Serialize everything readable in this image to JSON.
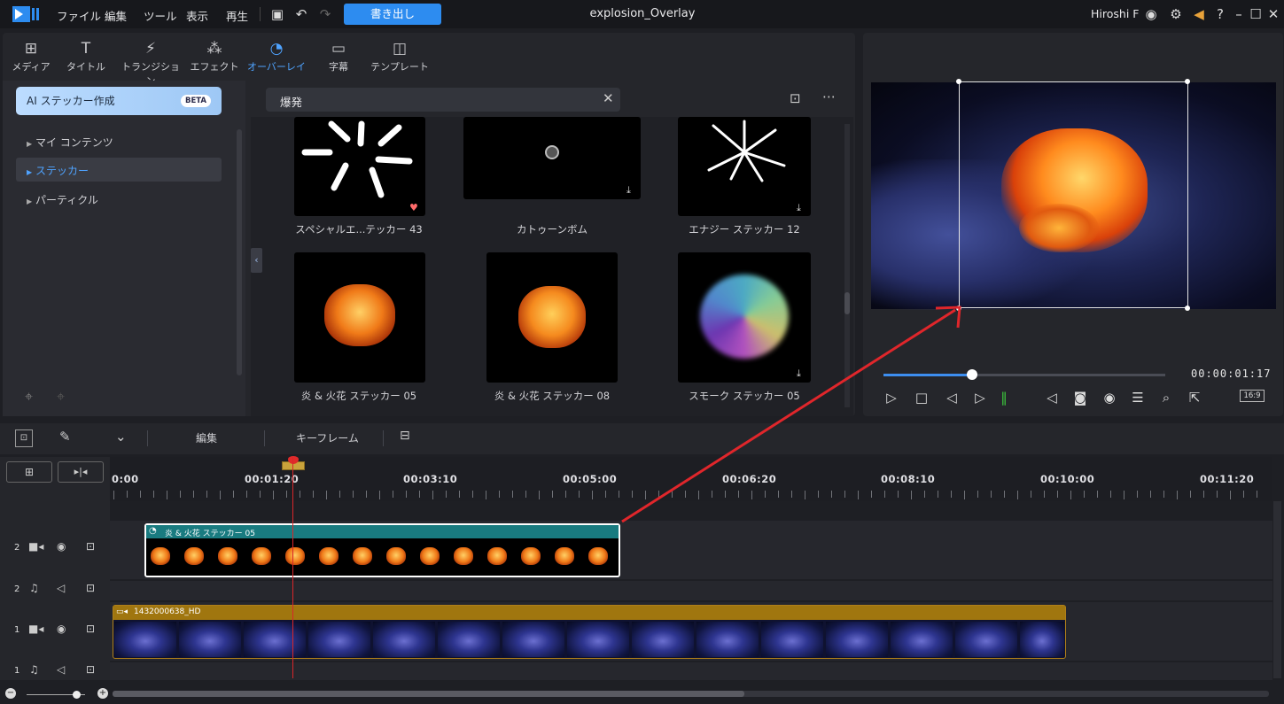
{
  "menu": {
    "items": [
      "ファイル",
      "編集",
      "ツール",
      "表示",
      "再生"
    ],
    "export_label": "書き出し",
    "window_title": "explosion_Overlay",
    "user_name": "Hiroshi F"
  },
  "toolbar_icons": [
    "save-icon",
    "undo-icon",
    "redo-icon",
    "account-icon",
    "settings-icon",
    "megaphone-icon",
    "help-icon",
    "minimize-icon",
    "maximize-icon",
    "close-icon"
  ],
  "library": {
    "tabs": [
      {
        "label": "メディア",
        "icon": "media-icon"
      },
      {
        "label": "タイトル",
        "icon": "title-icon"
      },
      {
        "label": "トランジション",
        "icon": "transition-icon"
      },
      {
        "label": "エフェクト",
        "icon": "effect-icon"
      },
      {
        "label": "オーバーレイ",
        "icon": "overlay-icon",
        "active": true
      },
      {
        "label": "字幕",
        "icon": "subtitle-icon"
      },
      {
        "label": "テンプレート",
        "icon": "template-icon"
      }
    ],
    "ai_button": "AI ステッカー作成",
    "beta": "BETA",
    "nav": [
      "マイ コンテンツ",
      "ステッカー",
      "パーティクル"
    ],
    "selected_nav": "ステッカー",
    "search_value": "爆発",
    "items": [
      "スペシャルエ...テッカー 43",
      "カトゥーンボム",
      "エナジー ステッカー 12",
      "炎 & 火花 ステッカー 05",
      "炎 & 火花 ステッカー 08",
      "スモーク ステッカー 05"
    ]
  },
  "preview": {
    "timecode": "00:00:01:17",
    "progress": 0.31,
    "aspect_ratio": "16:9"
  },
  "timeline": {
    "tools": {
      "edit": "編集",
      "keyframe": "キーフレーム"
    },
    "ruler": [
      "0:00",
      "00:01:20",
      "00:03:10",
      "00:05:00",
      "00:06:20",
      "00:08:10",
      "00:10:00",
      "00:11:20"
    ],
    "tracks": [
      {
        "number": "2",
        "type": "video"
      },
      {
        "number": "2",
        "type": "audio"
      },
      {
        "number": "1",
        "type": "video"
      },
      {
        "number": "1",
        "type": "audio"
      }
    ],
    "clips": {
      "overlay": "炎 & 火花 ステッカー 05",
      "video": "1432000638_HD"
    }
  },
  "colors": {
    "accent": "#2d8cf0",
    "playhead": "#d9262a",
    "annotation_arrow": "#e0262b",
    "overlay_clip": "#197b80",
    "video_clip": "#a0760f"
  }
}
